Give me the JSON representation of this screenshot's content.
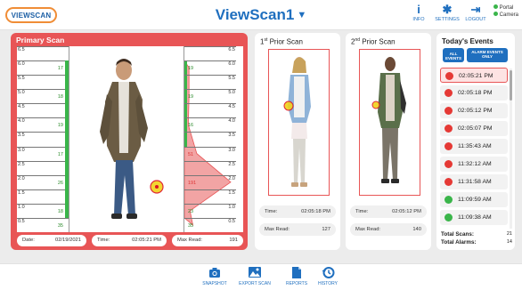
{
  "header": {
    "logo_text": "VIEWSCAN",
    "title": "ViewScan1",
    "buttons": [
      {
        "label": "INFO",
        "icon": "info-icon"
      },
      {
        "label": "SETTINGS",
        "icon": "gear-icon"
      },
      {
        "label": "LOGOUT",
        "icon": "logout-icon"
      }
    ],
    "status": [
      {
        "label": "Portal",
        "color": "#3ab54a"
      },
      {
        "label": "Camera",
        "color": "#3ab54a"
      }
    ]
  },
  "primary": {
    "title": "Primary Scan",
    "ticks": [
      "6.5",
      "6.0",
      "5.5",
      "5.0",
      "4.5",
      "4.0",
      "3.5",
      "3.0",
      "2.5",
      "2.0",
      "1.5",
      "1.0",
      "0.5"
    ],
    "left_counts": [
      {
        "tick": "6.0",
        "value": "17"
      },
      {
        "tick": "5.0",
        "value": "18"
      },
      {
        "tick": "4.0",
        "value": "19"
      },
      {
        "tick": "3.0",
        "value": "17"
      },
      {
        "tick": "2.0",
        "value": "26"
      },
      {
        "tick": "1.0",
        "value": "18"
      },
      {
        "tick": "0.5",
        "value": "35"
      }
    ],
    "right_counts": [
      {
        "tick": "6.0",
        "value": "19",
        "red": false
      },
      {
        "tick": "5.0",
        "value": "19",
        "red": false
      },
      {
        "tick": "4.0",
        "value": "16",
        "red": false
      },
      {
        "tick": "3.0",
        "value": "51",
        "red": true
      },
      {
        "tick": "2.0",
        "value": "191",
        "red": true
      },
      {
        "tick": "1.0",
        "value": "23",
        "red": false
      },
      {
        "tick": "0.5",
        "value": "35",
        "red": false
      }
    ],
    "date_label": "Date:",
    "date_value": "02/19/2021",
    "time_label": "Time:",
    "time_value": "02:05:21 PM",
    "maxread_label": "Max Read:",
    "maxread_value": "191"
  },
  "prior1": {
    "title_num": "1",
    "title_sup": "st",
    "title_rest": " Prior Scan",
    "time_label": "Time:",
    "time_value": "02:05:18 PM",
    "maxread_label": "Max Read:",
    "maxread_value": "127"
  },
  "prior2": {
    "title_num": "2",
    "title_sup": "nd",
    "title_rest": " Prior Scan",
    "time_label": "Time:",
    "time_value": "02:05:12 PM",
    "maxread_label": "Max Read:",
    "maxread_value": "140"
  },
  "events": {
    "title": "Today's Events",
    "all_label": "ALL EVENTS",
    "alarm_label": "ALARM EVENTS ONLY",
    "items": [
      {
        "time": "02:05:21 PM",
        "color": "#e53935"
      },
      {
        "time": "02:05:18 PM",
        "color": "#e53935"
      },
      {
        "time": "02:05:12 PM",
        "color": "#e53935"
      },
      {
        "time": "02:05:07 PM",
        "color": "#e53935"
      },
      {
        "time": "11:35:43 AM",
        "color": "#e53935"
      },
      {
        "time": "11:32:12 AM",
        "color": "#e53935"
      },
      {
        "time": "11:31:58 AM",
        "color": "#e53935"
      },
      {
        "time": "11:09:59 AM",
        "color": "#3ab54a"
      },
      {
        "time": "11:09:38 AM",
        "color": "#3ab54a"
      }
    ],
    "total_scans_label": "Total Scans:",
    "total_scans_value": "21",
    "total_alarms_label": "Total Alarms:",
    "total_alarms_value": "14"
  },
  "toolbar": {
    "buttons": [
      {
        "label": "SNAPSHOT",
        "icon": "camera-icon"
      },
      {
        "label": "EXPORT SCAN",
        "icon": "image-icon"
      },
      {
        "label": "REPORTS",
        "icon": "document-icon"
      },
      {
        "label": "HISTORY",
        "icon": "history-icon"
      }
    ]
  },
  "colors": {
    "accent": "#1f6fbf",
    "alarm": "#e85556",
    "ok": "#3ab54a"
  }
}
